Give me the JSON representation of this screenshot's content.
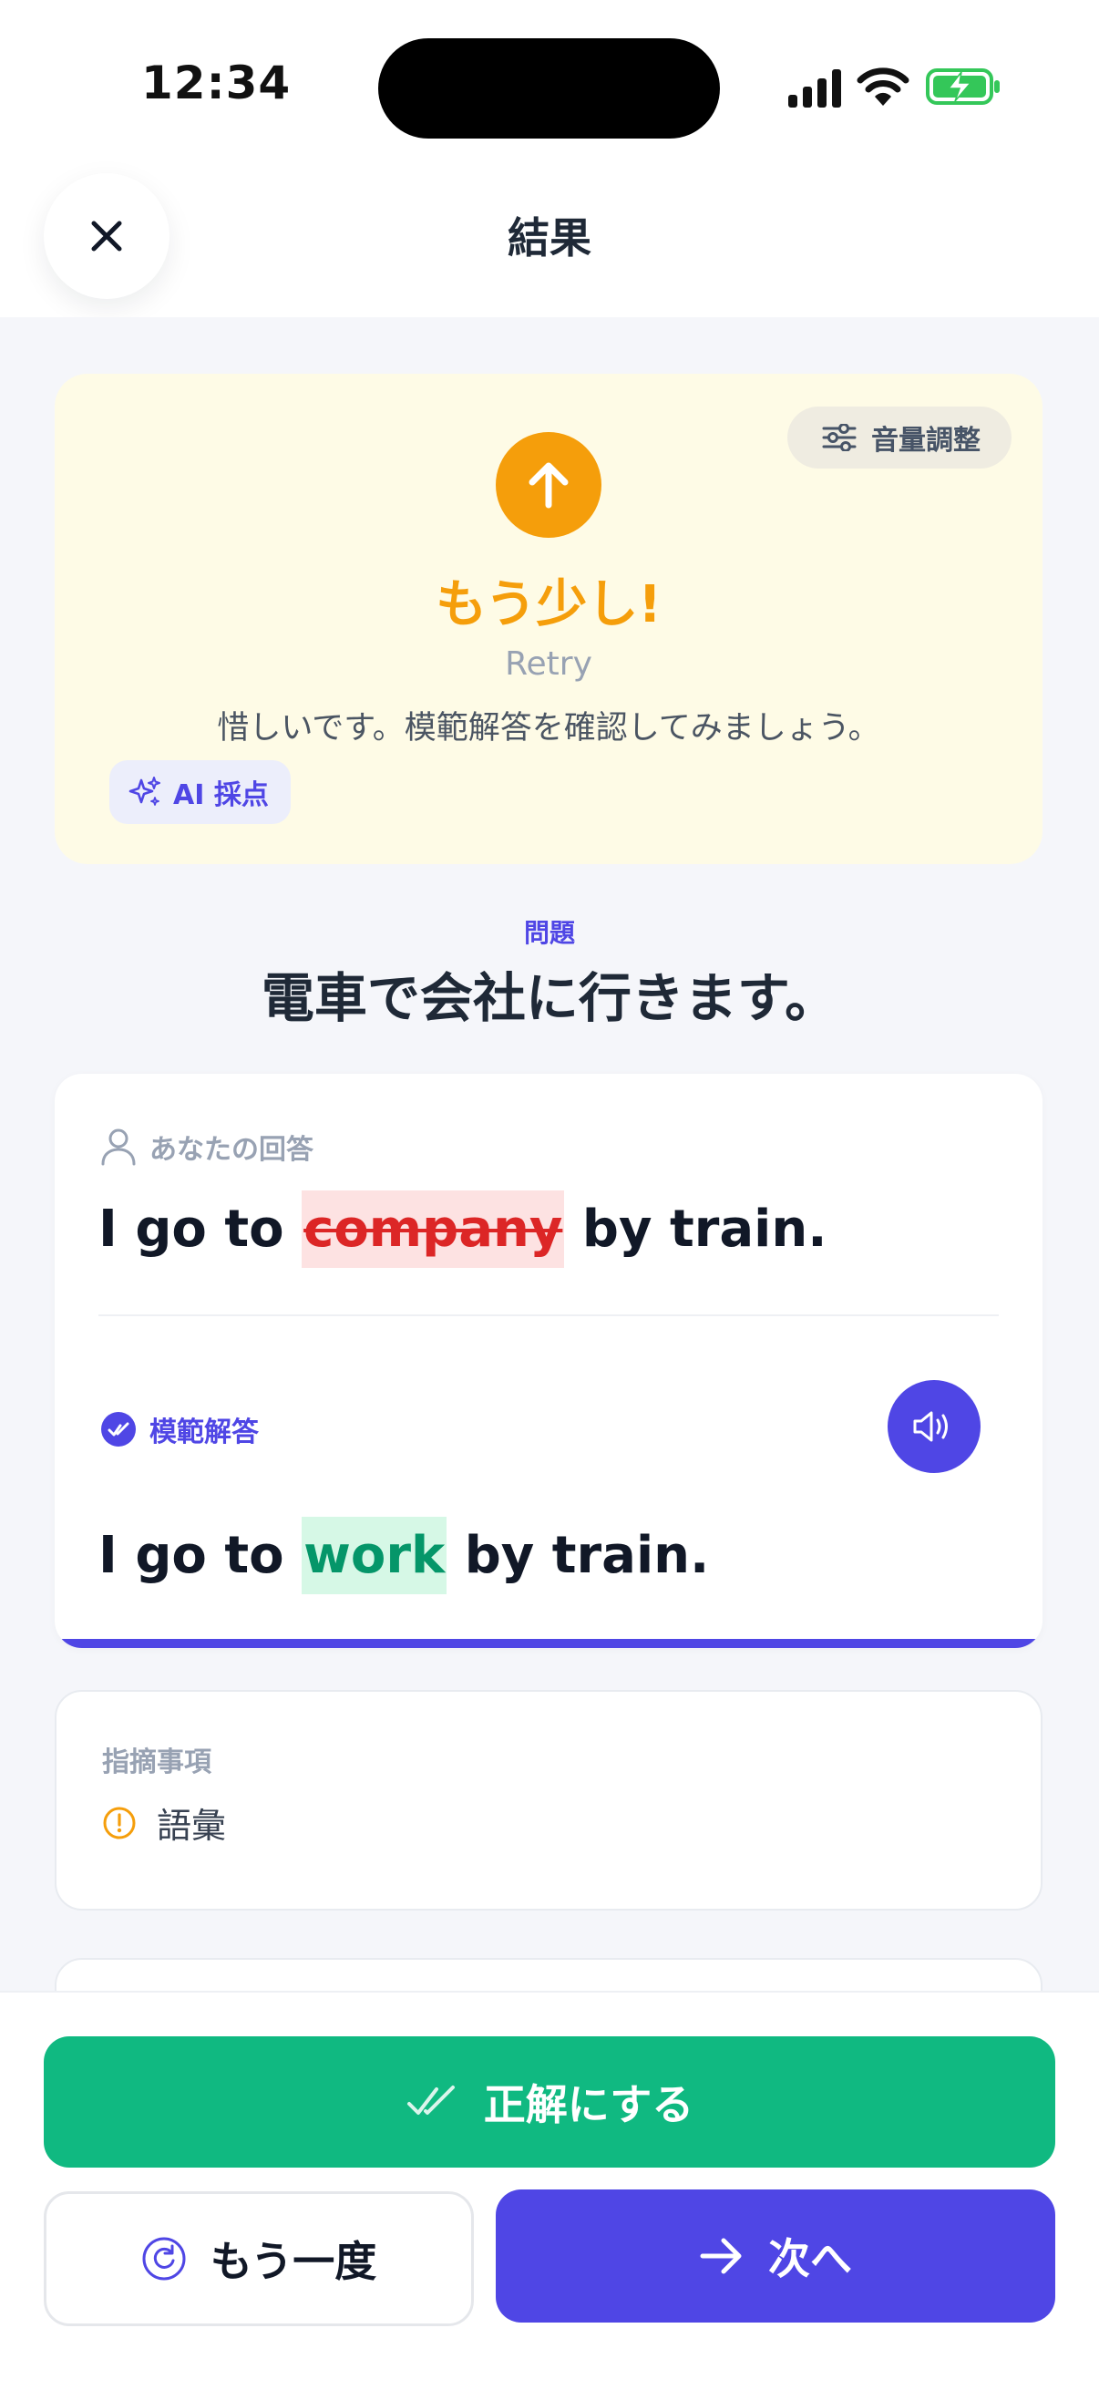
{
  "status_bar": {
    "time": "12:34"
  },
  "header": {
    "title": "結果"
  },
  "result": {
    "volume_label": "音量調整",
    "title": "もう少し!",
    "subtitle": "Retry",
    "message": "惜しいです。模範解答を確認してみましょう。",
    "ai_badge": "AI 採点"
  },
  "question": {
    "label": "問題",
    "text": "電車で会社に行きます。"
  },
  "your_answer": {
    "label": "あなたの回答",
    "before": "I go to ",
    "wrong_word": "company",
    "after": " by train."
  },
  "model_answer": {
    "label": "模範解答",
    "before": "I go to ",
    "correct_word": "work",
    "after": " by train."
  },
  "notes": {
    "title": "指摘事項",
    "items": [
      "語彙"
    ]
  },
  "actions": {
    "mark_correct": "正解にする",
    "retry": "もう一度",
    "next": "次へ"
  },
  "colors": {
    "accent": "#4f46e5",
    "success": "#10b981",
    "warning": "#f59e0b",
    "error": "#dc2626"
  }
}
